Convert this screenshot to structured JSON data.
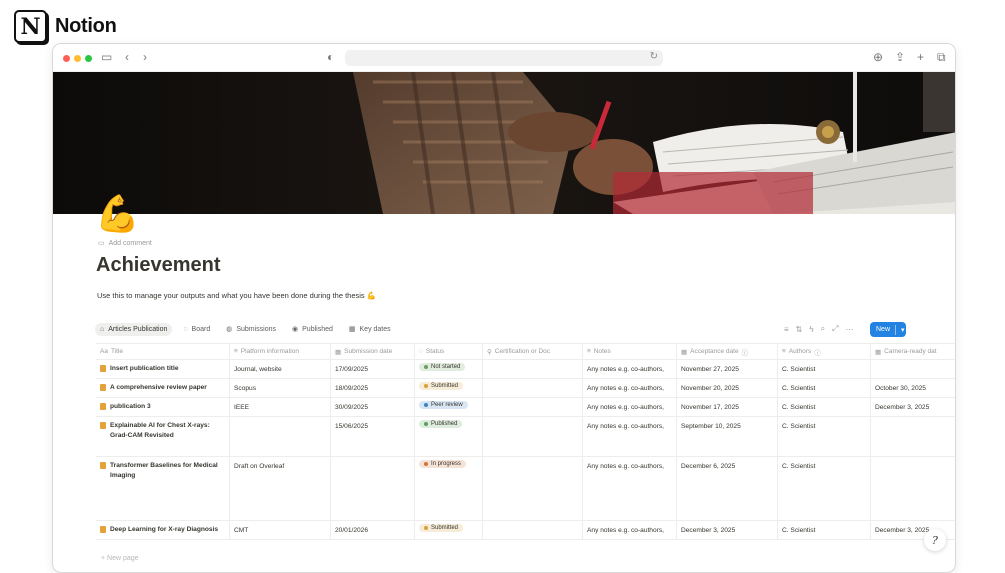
{
  "brand": {
    "logo": "N",
    "name": "Notion"
  },
  "page": {
    "icon": "💪",
    "add_comment": "Add comment",
    "title": "Achievement",
    "description": "Use this to manage your outputs and what you have been done during the thesis 💪"
  },
  "views": [
    {
      "label": "Articles Publication",
      "icon": "tab-icon"
    },
    {
      "label": "Board",
      "icon": "board-icon"
    },
    {
      "label": "Submissions",
      "icon": "submissions-icon"
    },
    {
      "label": "Published",
      "icon": "published-icon"
    },
    {
      "label": "Key dates",
      "icon": "calendar-icon"
    }
  ],
  "toolbar": {
    "new_label": "New"
  },
  "columns": {
    "title": "Title",
    "platform": "Platform information",
    "submission": "Submission date",
    "status": "Status",
    "certification": "Certification or Doc",
    "notes": "Notes",
    "acceptance": "Acceptance date",
    "authors": "Authors",
    "camera": "Camera-ready dat"
  },
  "status_colors": {
    "Not started": "#6b9e5f",
    "Submitted": "#d9a03a",
    "Peer review": "#3a83c4",
    "Published": "#5aa05a",
    "In progress": "#d0743a"
  },
  "rows": [
    {
      "title": "Insert publication title",
      "platform": "Journal, website",
      "submission": "17/09/2025",
      "status": "Not started",
      "notes": "Any notes e.g. co-authors,",
      "acceptance": "November 27, 2025",
      "authors": "C. Scientist",
      "camera": ""
    },
    {
      "title": "A comprehensive review paper",
      "platform": "Scopus",
      "submission": "18/09/2025",
      "status": "Submitted",
      "notes": "Any notes e.g. co-authors,",
      "acceptance": "November 20, 2025",
      "authors": "C. Scientist",
      "camera": "October 30, 2025"
    },
    {
      "title": "publication 3",
      "platform": "IEEE",
      "submission": "30/09/2025",
      "status": "Peer review",
      "notes": "Any notes e.g. co-authors,",
      "acceptance": "November 17, 2025",
      "authors": "C. Scientist",
      "camera": "December 3, 2025"
    },
    {
      "title": "Explainable AI for Chest X-rays: Grad-CAM Revisited",
      "platform": "",
      "submission": "15/06/2025",
      "status": "Published",
      "notes": "Any notes e.g. co-authors,",
      "acceptance": "September 10, 2025",
      "authors": "C. Scientist",
      "camera": ""
    },
    {
      "title": "Transformer Baselines for Medical Imaging",
      "platform": "Draft on Overleaf",
      "submission": "",
      "status": "In progress",
      "notes": "Any notes e.g. co-authors,",
      "acceptance": "December 6, 2025",
      "authors": "C. Scientist",
      "camera": ""
    },
    {
      "title": "Deep Learning for X-ray Diagnosis",
      "platform": "CMT",
      "submission": "20/01/2026",
      "status": "Submitted",
      "notes": "Any notes e.g. co-authors,",
      "acceptance": "December 3, 2025",
      "authors": "C. Scientist",
      "camera": "December 3, 2025"
    }
  ],
  "new_page": "+ New page",
  "help_glyph": "?"
}
